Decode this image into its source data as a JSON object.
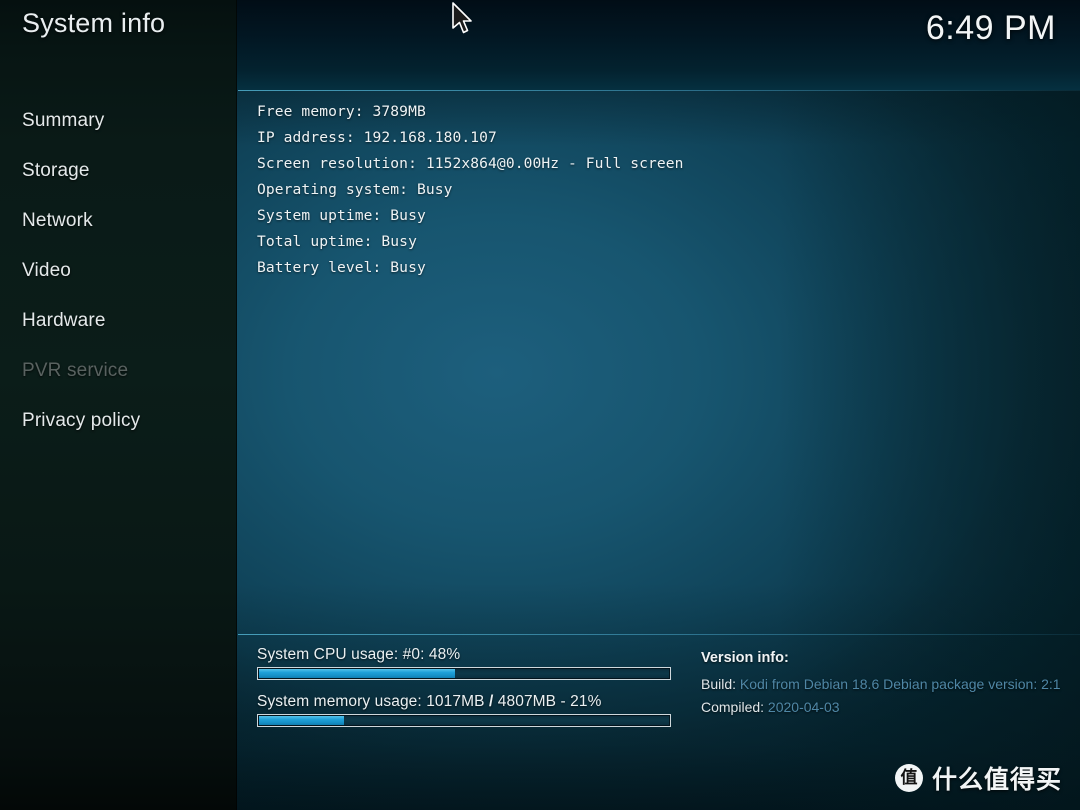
{
  "window": {
    "title": "System info",
    "clock": "6:49 PM"
  },
  "sidebar": {
    "items": [
      {
        "label": "Summary",
        "enabled": true
      },
      {
        "label": "Storage",
        "enabled": true
      },
      {
        "label": "Network",
        "enabled": true
      },
      {
        "label": "Video",
        "enabled": true
      },
      {
        "label": "Hardware",
        "enabled": true
      },
      {
        "label": "PVR service",
        "enabled": false
      },
      {
        "label": "Privacy policy",
        "enabled": true
      }
    ]
  },
  "summary": {
    "lines": [
      "Free memory: 3789MB",
      "IP address: 192.168.180.107",
      "Screen resolution: 1152x864@0.00Hz - Full screen",
      "Operating system: Busy",
      "System uptime: Busy",
      "Total uptime: Busy",
      "Battery level: Busy"
    ]
  },
  "usage": {
    "cpu": {
      "label": "System CPU usage: #0:  48%",
      "percent": 48
    },
    "memory": {
      "label_pre": "System memory usage: 1017MB ",
      "label_sep": "/",
      "label_post": " 4807MB - 21%",
      "percent": 21
    }
  },
  "version": {
    "title": "Version info:",
    "build_label": "Build: ",
    "build_value": "Kodi from Debian 18.6 Debian package version: 2:1",
    "compiled_label": "Compiled: ",
    "compiled_value": "2020-04-03"
  },
  "watermark": {
    "logo_glyph": "值",
    "text": "什么值得买"
  },
  "colors": {
    "accent": "#1ea0d8",
    "separator": "#50afcd",
    "sidebar_bg": "#0b1d19",
    "content_bg": "#15566f",
    "text": "#eef3f5",
    "text_disabled": "#596260",
    "version_value": "#4f87a6"
  }
}
